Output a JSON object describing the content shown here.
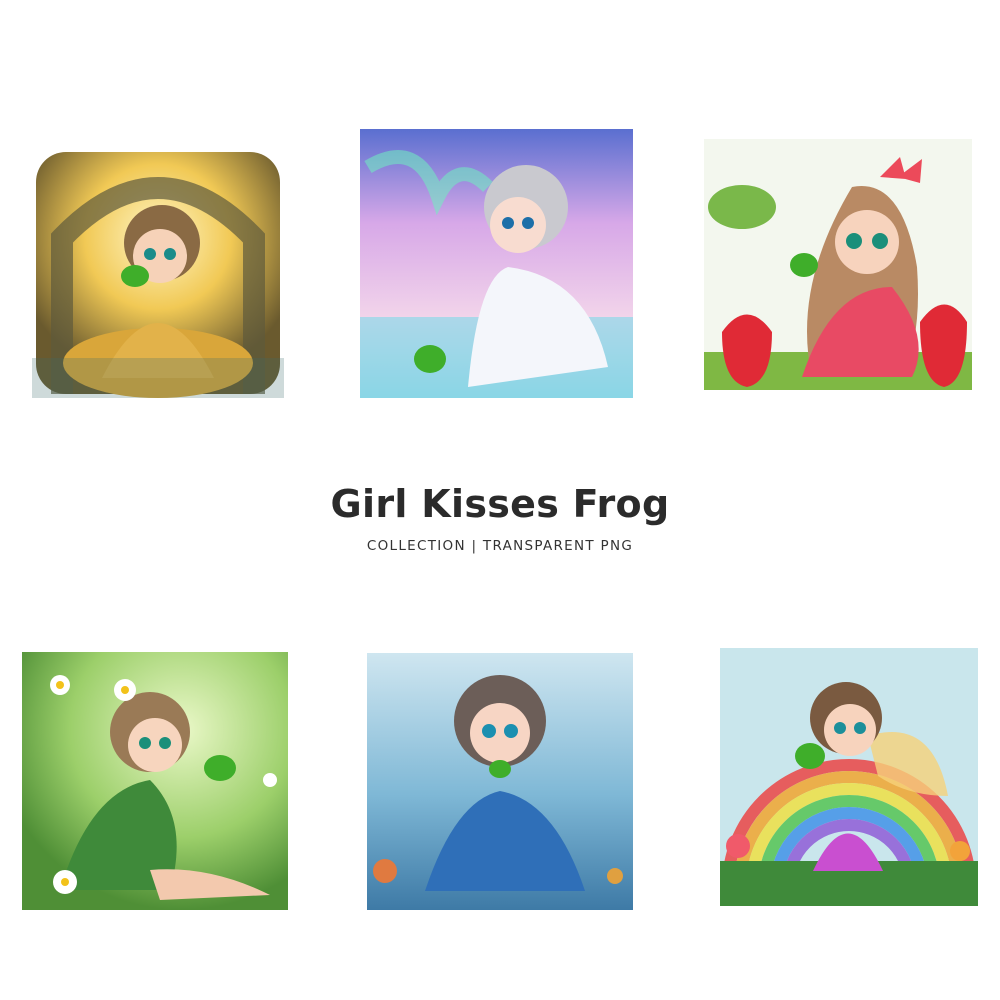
{
  "title": "Girl Kisses Frog",
  "subtitle": "COLLECTION | TRANSPARENT PNG",
  "colors": {
    "background": "#ffffff",
    "title_text": "#2b2b2b",
    "frog_green": "#3fae2a"
  },
  "illustrations": [
    {
      "theme": "golden-archway",
      "frog": true
    },
    {
      "theme": "winter-aurora",
      "frog": true
    },
    {
      "theme": "strawberry-garden",
      "frog": true
    },
    {
      "theme": "daisy-meadow",
      "frog": true
    },
    {
      "theme": "blue-underwater",
      "frog": true
    },
    {
      "theme": "rainbow-fairy",
      "frog": true
    }
  ]
}
